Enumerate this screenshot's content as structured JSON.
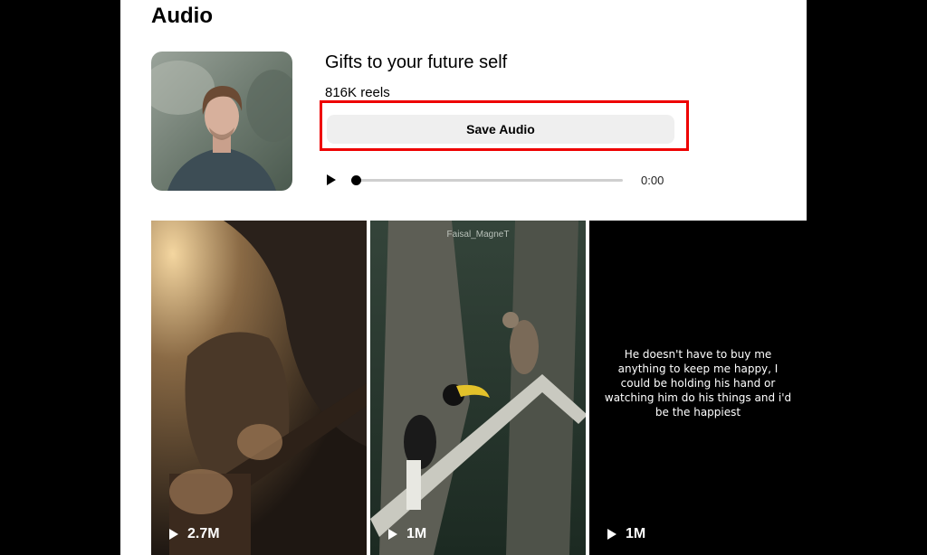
{
  "header": {
    "title": "Audio"
  },
  "audio": {
    "title": "Gifts to your future self",
    "reel_count": "816K reels",
    "save_label": "Save Audio",
    "time": "0:00",
    "progress": 0.0
  },
  "reels": [
    {
      "views": "2.7M",
      "caption": "",
      "watermark": ""
    },
    {
      "views": "1M",
      "caption": "",
      "watermark": "Faisal_MagneT"
    },
    {
      "views": "1M",
      "caption": "He doesn't have to buy me anything to keep me happy, I could be holding his hand or watching him do his things and i'd be the happiest",
      "watermark": ""
    }
  ],
  "colors": {
    "highlight": "#ee0000",
    "button_bg": "#efefef"
  },
  "icons": [
    "play-icon",
    "cover-image",
    "reel-thumbnail"
  ]
}
